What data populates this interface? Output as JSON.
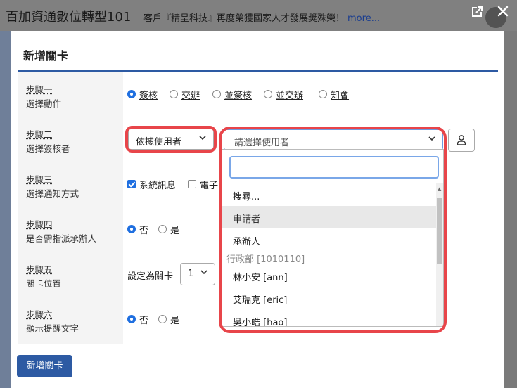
{
  "app": {
    "title": "百加資通數位轉型101",
    "news": "客戶『精呈科技』再度榮獲國家人才發展獎殊榮！",
    "news_more": "more..."
  },
  "modal": {
    "title": "新增關卡",
    "steps": [
      {
        "label": "步驟一",
        "desc": "選擇動作"
      },
      {
        "label": "步驟二",
        "desc": "選擇簽核者"
      },
      {
        "label": "步驟三",
        "desc": "選擇通知方式"
      },
      {
        "label": "步驟四",
        "desc": "是否需指派承辦人"
      },
      {
        "label": "步驟五",
        "desc": "關卡位置"
      },
      {
        "label": "步驟六",
        "desc": "顯示提醒文字"
      }
    ],
    "actions": [
      "簽核",
      "交辦",
      "並簽核",
      "並交辦",
      "知會"
    ],
    "selected_action": "簽核",
    "approver_type": "依據使用者",
    "user_placeholder": "請選擇使用者",
    "notify": {
      "system_msg": "系統訊息",
      "email_partial": "電子"
    },
    "assign": {
      "no": "否",
      "yes": "是"
    },
    "position": {
      "prefix": "設定為關卡",
      "value": "1"
    },
    "reminder": {
      "no": "否",
      "yes": "是"
    },
    "submit": "新增關卡"
  },
  "dropdown": {
    "search_value": "",
    "items": [
      {
        "type": "item",
        "text": "搜尋..."
      },
      {
        "type": "item",
        "text": "申請者",
        "highlight": true
      },
      {
        "type": "item",
        "text": "承辦人"
      },
      {
        "type": "group",
        "text": "行政部 [1010110]"
      },
      {
        "type": "item",
        "text": "林小安 [ann]"
      },
      {
        "type": "item",
        "text": "艾瑞克 [eric]"
      },
      {
        "type": "item",
        "text": "吳小皓 [hao]"
      }
    ]
  },
  "colors": {
    "accent": "#2d5aa3",
    "highlight_frame": "#e8454a",
    "radio_on": "#1f6fe0"
  }
}
